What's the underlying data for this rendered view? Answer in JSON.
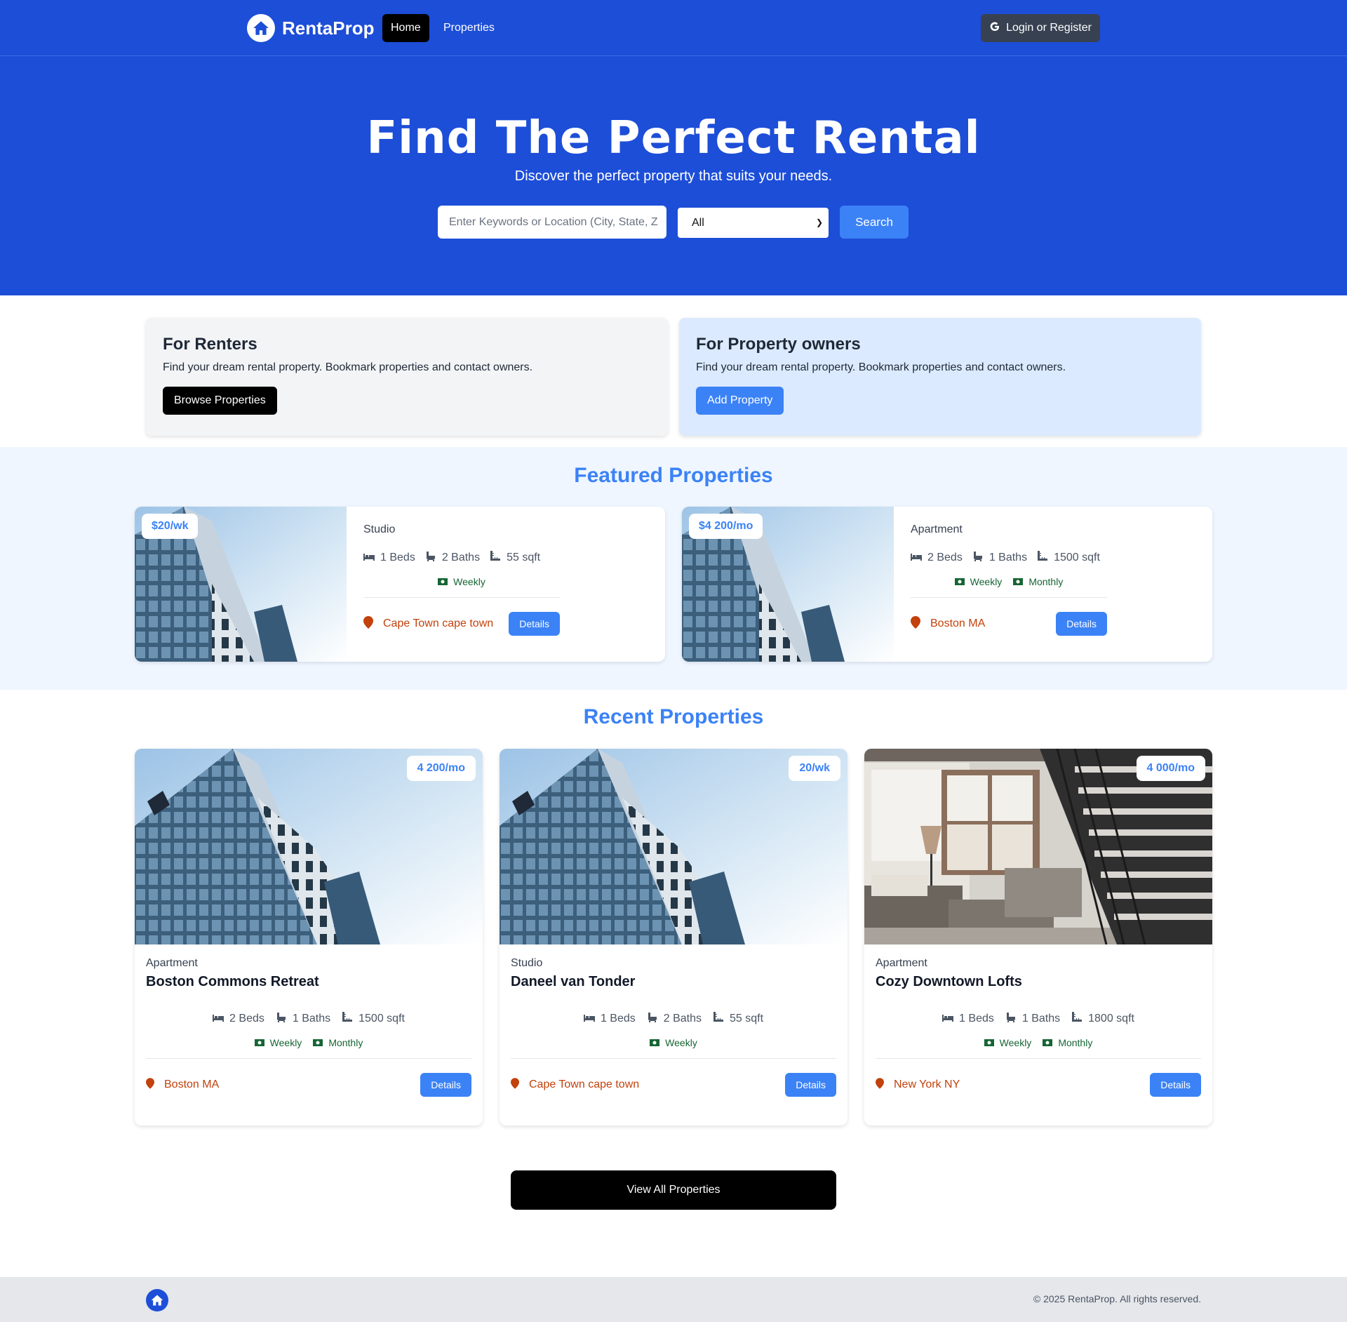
{
  "nav": {
    "brand": "RentaProp",
    "links": [
      "Home",
      "Properties"
    ],
    "login_label": "Login or Register"
  },
  "hero": {
    "title": "Find The Perfect Rental",
    "subtitle": "Discover the perfect property that suits your needs.",
    "search_placeholder": "Enter Keywords or Location (City, State, Z",
    "type_selected": "All",
    "search_label": "Search"
  },
  "info": {
    "renters": {
      "title": "For Renters",
      "text": "Find your dream rental property. Bookmark properties and contact owners.",
      "button": "Browse Properties"
    },
    "owners": {
      "title": "For Property owners",
      "text": "Find your dream rental property. Bookmark properties and contact owners.",
      "button": "Add Property"
    }
  },
  "featured": {
    "title": "Featured Properties",
    "items": [
      {
        "price": "$20/wk",
        "type": "Studio",
        "beds": "1 Beds",
        "baths": "2 Baths",
        "sqft": "55 sqft",
        "rates": [
          "Weekly"
        ],
        "location": "Cape Town cape town",
        "details": "Details"
      },
      {
        "price": "$4 200/mo",
        "type": "Apartment",
        "beds": "2 Beds",
        "baths": "1 Baths",
        "sqft": "1500 sqft",
        "rates": [
          "Weekly",
          "Monthly"
        ],
        "location": "Boston MA",
        "details": "Details"
      }
    ]
  },
  "recent": {
    "title": "Recent Properties",
    "items": [
      {
        "price": "4 200/mo",
        "type": "Apartment",
        "name": "Boston Commons Retreat",
        "beds": "2 Beds",
        "baths": "1 Baths",
        "sqft": "1500 sqft",
        "rates": [
          "Weekly",
          "Monthly"
        ],
        "location": "Boston MA",
        "details": "Details"
      },
      {
        "price": "20/wk",
        "type": "Studio",
        "name": "Daneel van Tonder",
        "beds": "1 Beds",
        "baths": "2 Baths",
        "sqft": "55 sqft",
        "rates": [
          "Weekly"
        ],
        "location": "Cape Town cape town",
        "details": "Details"
      },
      {
        "price": "4 000/mo",
        "type": "Apartment",
        "name": "Cozy Downtown Lofts",
        "beds": "1 Beds",
        "baths": "1 Baths",
        "sqft": "1800 sqft",
        "rates": [
          "Weekly",
          "Monthly"
        ],
        "location": "New York NY",
        "details": "Details"
      }
    ],
    "view_all": "View All Properties"
  },
  "footer": {
    "copyright": "© 2025 RentaProp. All rights reserved."
  },
  "colors": {
    "primary": "#1d4ed8",
    "accent": "#3b82f6",
    "location": "#c2410c",
    "rate": "#166534"
  },
  "icons": {
    "brand": "house-icon",
    "login": "google-icon",
    "beds": "bed-icon",
    "baths": "bath-icon",
    "sqft": "ruler-icon",
    "rate": "money-icon",
    "location": "map-marker-icon"
  }
}
